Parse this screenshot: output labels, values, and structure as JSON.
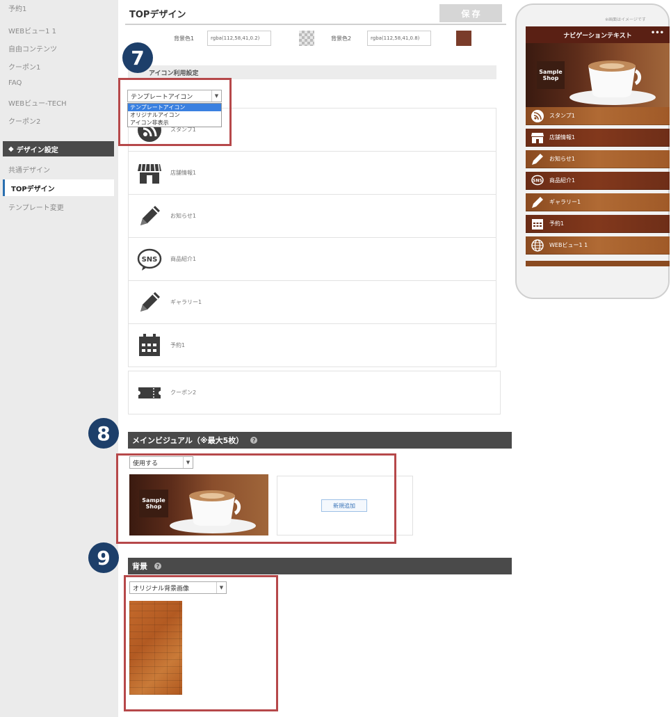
{
  "sidebar": {
    "items_top": [
      "予約1",
      "WEBビュー1 1",
      "自由コンテンツ",
      "クーポン1",
      "FAQ",
      "WEBビュー-TECH",
      "クーポン2"
    ],
    "section_title": "デザイン設定",
    "items_bottom": [
      "共通デザイン",
      "TOPデザイン",
      "テンプレート変更"
    ]
  },
  "header": {
    "title": "TOPデザイン",
    "save_label": "保 存"
  },
  "background": {
    "label1": "背景色1",
    "value1": "rgba(112,58,41,0.2)",
    "label2": "背景色2",
    "value2": "rgba(112,58,41,0.8)"
  },
  "icon_settings": {
    "label": "アイコン利用設定",
    "select_value": "テンプレートアイコン",
    "options": [
      "テンプレートアイコン",
      "オリジナルアイコン",
      "アイコン非表示"
    ]
  },
  "icon_list": [
    {
      "icon": "stamp-icon",
      "label": "スタンプ1"
    },
    {
      "icon": "shop-icon",
      "label": "店舗情報1"
    },
    {
      "icon": "pencil-icon",
      "label": "お知らせ1"
    },
    {
      "icon": "sns-icon",
      "label": "商品紹介1"
    },
    {
      "icon": "pencil-icon",
      "label": "ギャラリー1"
    },
    {
      "icon": "calendar-icon",
      "label": "予約1"
    },
    {
      "icon": "ticket-icon",
      "label": "クーポン2"
    }
  ],
  "main_visual": {
    "title": "メインビジュアル（※最大5枚）",
    "select_value": "使用する",
    "add_label": "新規追加",
    "image_text": "Sample Shop"
  },
  "background_section": {
    "title": "背景",
    "select_value": "オリジナル背景画像"
  },
  "markers": [
    "7",
    "8",
    "9"
  ],
  "phone": {
    "note": "※画面はイメージです",
    "header": "ナビゲーションテキスト",
    "menu": "•••",
    "badge": "Sample Shop",
    "items": [
      {
        "icon": "rss-icon",
        "label": "スタンプ1"
      },
      {
        "icon": "shop-icon",
        "label": "店舗情報1"
      },
      {
        "icon": "pencil-icon",
        "label": "お知らせ1"
      },
      {
        "icon": "sns-icon",
        "label": "商品紹介1"
      },
      {
        "icon": "pencil-icon",
        "label": "ギャラリー1"
      },
      {
        "icon": "calendar-icon",
        "label": "予約1"
      },
      {
        "icon": "globe-icon",
        "label": "WEBビュー1 1"
      }
    ]
  },
  "colors": {
    "marker": "#1d3f6a",
    "highlight_box": "#b6484a",
    "dark_bar": "#4a4a4a",
    "phone_header": "#5a2014"
  }
}
